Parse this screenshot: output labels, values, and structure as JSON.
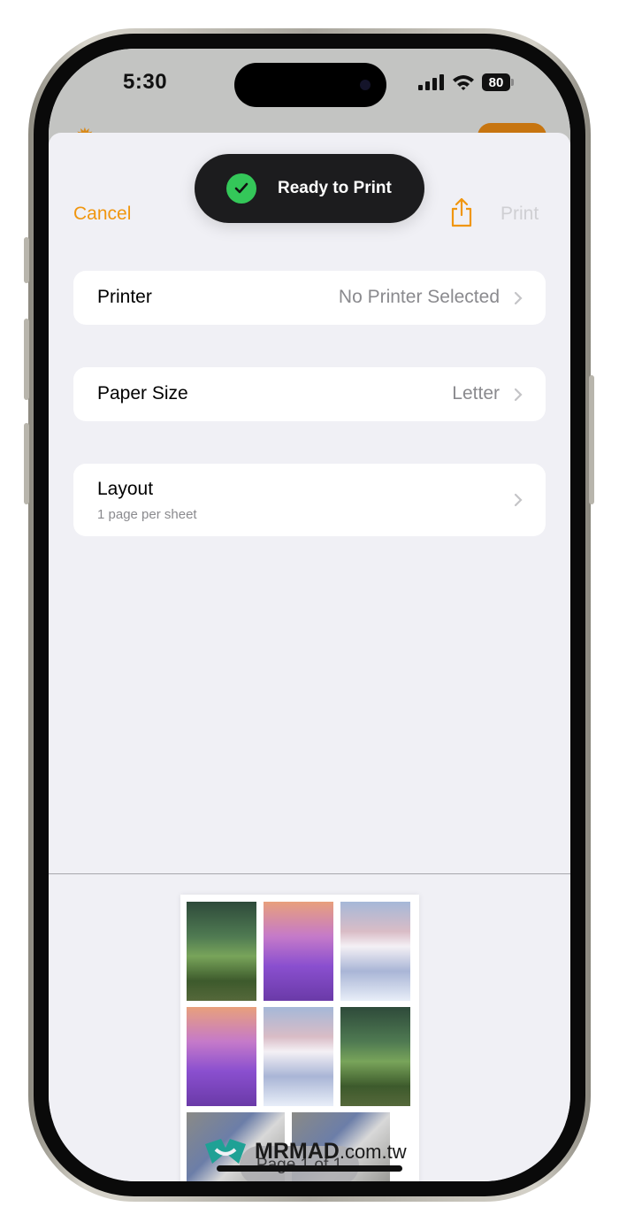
{
  "status_bar": {
    "time": "5:30",
    "battery": "80",
    "icons": [
      "cellular-signal-icon",
      "wifi-icon",
      "battery-icon"
    ]
  },
  "nav": {
    "cancel_label": "Cancel",
    "share_icon": "share-icon",
    "print_label": "Print"
  },
  "toast": {
    "icon": "checkmark-circle-icon",
    "text": "Ready to Print"
  },
  "options": [
    {
      "label": "Printer",
      "value": "No Printer Selected"
    },
    {
      "label": "Paper Size",
      "value": "Letter"
    },
    {
      "label": "Layout",
      "subtitle": "1 page per sheet"
    }
  ],
  "preview": {
    "thumbnails": [
      "forest path",
      "lavender field",
      "snowy mountain",
      "lavender field",
      "snowy mountain",
      "forest path",
      "blue jay",
      "blue jay"
    ],
    "page_indicator": "Page 1 of 1"
  },
  "colors": {
    "accent": "#f0960f",
    "disabled": "#cfcfd3",
    "success": "#34c759"
  },
  "watermark": {
    "brand": "MRMAD",
    "domain": ".com.tw"
  }
}
